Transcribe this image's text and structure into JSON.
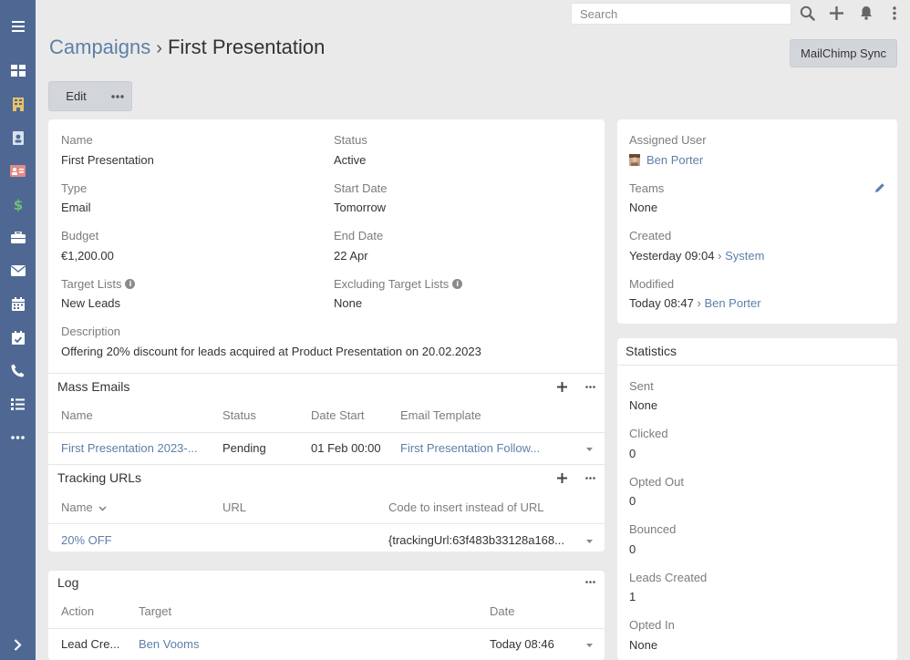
{
  "search": {
    "placeholder": "Search"
  },
  "sidebar": {
    "items": [
      {
        "name": "menu-icon"
      },
      {
        "name": "dashboard-icon"
      },
      {
        "name": "accounts-icon"
      },
      {
        "name": "contacts-icon"
      },
      {
        "name": "leads-icon"
      },
      {
        "name": "opportunities-icon"
      },
      {
        "name": "cases-icon"
      },
      {
        "name": "emails-icon"
      },
      {
        "name": "calendar-icon"
      },
      {
        "name": "tasks-icon"
      },
      {
        "name": "calls-icon"
      },
      {
        "name": "list-icon"
      },
      {
        "name": "more-icon"
      },
      {
        "name": "collapse-icon"
      }
    ]
  },
  "header": {
    "breadcrumb_parent": "Campaigns",
    "separator": "›",
    "title": "First Presentation",
    "mailchimp_button": "MailChimp Sync",
    "edit_button": "Edit"
  },
  "details": {
    "name_label": "Name",
    "name_value": "First Presentation",
    "status_label": "Status",
    "status_value": "Active",
    "type_label": "Type",
    "type_value": "Email",
    "start_date_label": "Start Date",
    "start_date_value": "Tomorrow",
    "budget_label": "Budget",
    "budget_value": "€1,200.00",
    "end_date_label": "End Date",
    "end_date_value": "22 Apr",
    "target_lists_label": "Target Lists",
    "target_lists_value": "New Leads",
    "excluding_label": "Excluding Target Lists",
    "excluding_value": "None",
    "description_label": "Description",
    "description_value": "Offering 20% discount for leads acquired at Product Presentation on 20.02.2023"
  },
  "mass_emails": {
    "title": "Mass Emails",
    "columns": [
      "Name",
      "Status",
      "Date Start",
      "Email Template"
    ],
    "rows": [
      {
        "name": "First Presentation 2023-...",
        "status": "Pending",
        "date_start": "01 Feb 00:00",
        "template": "First Presentation Follow..."
      }
    ]
  },
  "tracking_urls": {
    "title": "Tracking URLs",
    "columns": [
      "Name",
      "URL",
      "Code to insert instead of URL"
    ],
    "rows": [
      {
        "name": "20% OFF",
        "url": "",
        "code": "{trackingUrl:63f483b33128a168..."
      }
    ]
  },
  "log": {
    "title": "Log",
    "columns": [
      "Action",
      "Target",
      "Date"
    ],
    "rows": [
      {
        "action": "Lead Cre...",
        "target": "Ben Vooms",
        "date": "Today 08:46"
      }
    ]
  },
  "side": {
    "assigned_user_label": "Assigned User",
    "assigned_user_value": "Ben Porter",
    "teams_label": "Teams",
    "teams_value": "None",
    "created_label": "Created",
    "created_value": "Yesterday 09:04",
    "created_by": "System",
    "modified_label": "Modified",
    "modified_value": "Today 08:47",
    "modified_by": "Ben Porter",
    "arrow": "›"
  },
  "statistics": {
    "title": "Statistics",
    "items": [
      {
        "label": "Sent",
        "value": "None"
      },
      {
        "label": "Clicked",
        "value": "0"
      },
      {
        "label": "Opted Out",
        "value": "0"
      },
      {
        "label": "Bounced",
        "value": "0"
      },
      {
        "label": "Leads Created",
        "value": "1"
      },
      {
        "label": "Opted In",
        "value": "None"
      }
    ]
  },
  "colors": {
    "sidebar": "#4e6893",
    "link": "#5d7fa8",
    "background": "#eaeaea",
    "money": "#6fbf73",
    "accounts": "#e8c26a",
    "leads": "#e38a8a"
  }
}
